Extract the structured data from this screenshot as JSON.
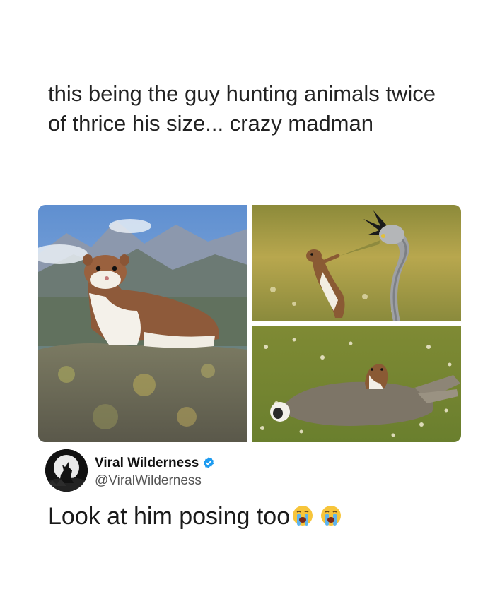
{
  "post": {
    "caption": "this being the guy hunting animals twice of thrice his size... crazy madman"
  },
  "photos": [
    {
      "name": "weasel-on-rock"
    },
    {
      "name": "weasel-vs-heron"
    },
    {
      "name": "weasel-riding-rabbit"
    }
  ],
  "quoted_tweet": {
    "display_name": "Viral Wilderness",
    "handle": "@ViralWilderness",
    "verified": true,
    "text": "Look at him posing too",
    "emojis": [
      "loudly-crying-face",
      "loudly-crying-face"
    ]
  },
  "colors": {
    "background": "#ffffff",
    "verified_badge": "#1d9bf0",
    "handle_text": "#555555"
  }
}
